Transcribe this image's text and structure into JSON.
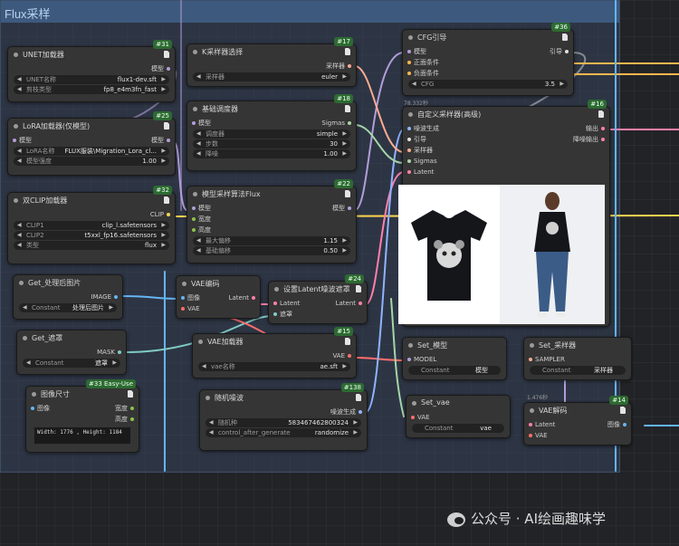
{
  "group": {
    "title": "Flux采样"
  },
  "colors": {
    "group_header": "#3d5a7e",
    "badge": "#2d6a32",
    "model_wire": "#b39ddb",
    "clip_wire": "#ffd54f",
    "latent_wire": "#ff80ab",
    "vae_wire": "#ff6e6e",
    "image_wire": "#64b5f6",
    "mask_wire": "#80cbc4"
  },
  "nodes": {
    "unet": {
      "badge": "#31",
      "title": "UNET加载器",
      "out_model": "模型",
      "w1_label": "UNET名称",
      "w1_value": "flux1-dev.sft",
      "w2_label": "剪枝类型",
      "w2_value": "fp8_e4m3fn_fast"
    },
    "lora": {
      "badge": "#25",
      "title": "LoRA加载器(仅模型)",
      "in_model": "模型",
      "out_model": "模型",
      "w1_label": "LoRA名称",
      "w1_value": "FLUX服装\\Migration_Lora_cl...",
      "w2_label": "模型强度",
      "w2_value": "1.00"
    },
    "dualclip": {
      "badge": "#32",
      "title": "双CLIP加载器",
      "out_clip": "CLIP",
      "w1_label": "CLIP1",
      "w1_value": "clip_l.safetensors",
      "w2_label": "CLIP2",
      "w2_value": "t5xxl_fp16.safetensors",
      "w3_label": "类型",
      "w3_value": "flux"
    },
    "get_image": {
      "title": "Get_处理后图片",
      "out": "IMAGE",
      "w1_label": "Constant",
      "w1_value": "处理后图片"
    },
    "get_mask": {
      "title": "Get_遮罩",
      "out": "MASK",
      "w1_label": "Constant",
      "w1_value": "遮罩"
    },
    "imgsize": {
      "badge": "#33 Easy-Use",
      "title": "图像尺寸",
      "in_image": "图像",
      "out_w": "宽度",
      "out_h": "高度",
      "text": "Width: 1776 , Height: 1184"
    },
    "ksampler_select": {
      "badge": "#17",
      "title": "K采样器选择",
      "out": "采样器",
      "w1_label": "采样器",
      "w1_value": "euler"
    },
    "scheduler": {
      "badge": "#18",
      "title": "基础调度器",
      "in_model": "模型",
      "out": "Sigmas",
      "w1_label": "调度器",
      "w1_value": "simple",
      "w2_label": "步数",
      "w2_value": "30",
      "w3_label": "降噪",
      "w3_value": "1.00"
    },
    "modelsampling": {
      "badge": "#22",
      "title": "模型采样算法Flux",
      "in_model": "模型",
      "in_w": "宽度",
      "in_h": "高度",
      "out": "模型",
      "w1_label": "最大偏移",
      "w1_value": "1.15",
      "w2_label": "基础偏移",
      "w2_value": "0.50"
    },
    "vaeencode": {
      "title": "VAE编码",
      "in_image": "图像",
      "in_vae": "VAE",
      "out": "Latent"
    },
    "setlatentmask": {
      "badge": "#24",
      "title": "设置Latent噪波遮罩",
      "in_latent": "Latent",
      "in_mask": "遮罩",
      "out": "Latent"
    },
    "vaeloader": {
      "badge": "#15",
      "title": "VAE加载器",
      "out": "VAE",
      "w1_label": "vae名称",
      "w1_value": "ae.sft"
    },
    "randomnoise": {
      "badge": "#138",
      "title": "随机噪波",
      "out": "噪波生成",
      "w1_label": "随机种",
      "w1_value": "583467462800324",
      "w2_label": "control_after_generate",
      "w2_value": "randomize"
    },
    "cfg": {
      "badge": "#36",
      "title": "CFG引导",
      "in_model": "模型",
      "in_pos": "正面条件",
      "in_neg": "负面条件",
      "out": "引导",
      "w1_label": "CFG",
      "w1_value": "3.5",
      "time": "78.332秒"
    },
    "customsampler": {
      "badge": "#16",
      "title": "自定义采样器(高级)",
      "in_noise": "噪波生成",
      "in_guide": "引导",
      "in_sampler": "采样器",
      "in_sigmas": "Sigmas",
      "in_latent": "Latent",
      "out1": "输出",
      "out2": "降噪输出"
    },
    "set_model": {
      "title": "Set_模型",
      "in": "MODEL",
      "w1_label": "Constant",
      "w1_value": "模型"
    },
    "set_sampler": {
      "title": "Set_采样器",
      "in": "SAMPLER",
      "w1_label": "Constant",
      "w1_value": "采样器"
    },
    "set_vae": {
      "title": "Set_vae",
      "in": "VAE",
      "w1_label": "Constant",
      "w1_value": "vae"
    },
    "vaedecode": {
      "badge": "#14",
      "title": "VAE解码",
      "in_latent": "Latent",
      "in_vae": "VAE",
      "out": "图像",
      "time": "1.476秒"
    }
  },
  "watermark": {
    "text": "公众号 · AI绘画趣味学"
  }
}
